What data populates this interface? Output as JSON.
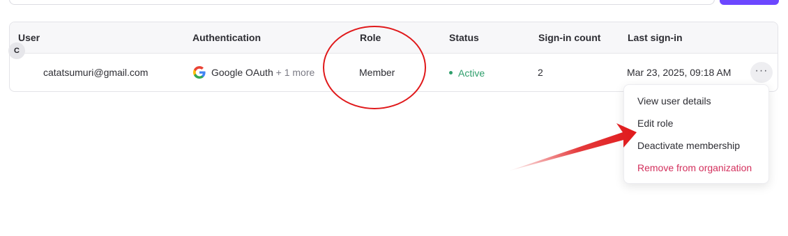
{
  "table": {
    "headers": {
      "user": "User",
      "authentication": "Authentication",
      "role": "Role",
      "status": "Status",
      "sign_in_count": "Sign-in count",
      "last_sign_in": "Last sign-in"
    },
    "rows": [
      {
        "avatar_initial": "C",
        "email": "catatsumuri@gmail.com",
        "auth_provider": "Google OAuth",
        "auth_more": "+ 1 more",
        "role": "Member",
        "status": "Active",
        "sign_in_count": "2",
        "last_sign_in": "Mar 23, 2025, 09:18 AM"
      }
    ],
    "row_actions_label": "···"
  },
  "menu": {
    "items": [
      {
        "label": "View user details"
      },
      {
        "label": "Edit role"
      },
      {
        "label": "Deactivate membership"
      },
      {
        "label": "Remove from organization"
      }
    ]
  },
  "colors": {
    "accent": "#6c47ff",
    "status_active": "#2e9e6b",
    "danger": "#d32f5c",
    "annotation": "#e0191b"
  },
  "icons": {
    "auth_provider": "google-logo-icon",
    "status": "status-dot-icon",
    "row_actions": "more-horizontal-icon"
  }
}
